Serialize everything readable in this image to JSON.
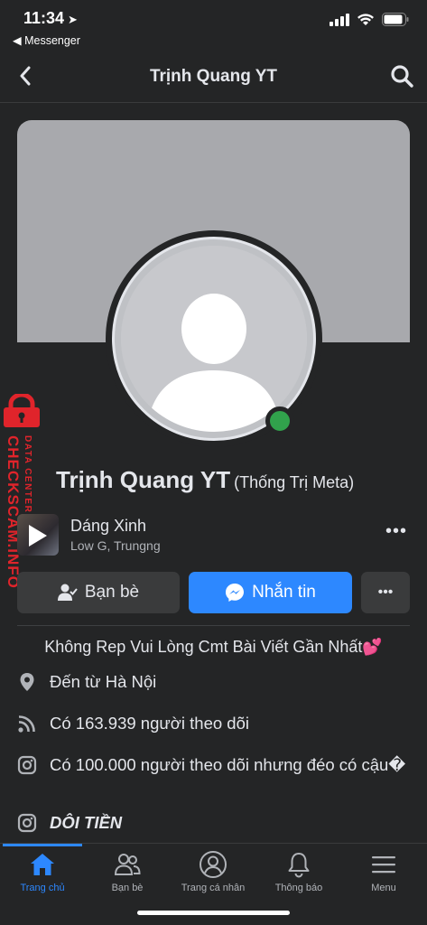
{
  "status_bar": {
    "time": "11:34",
    "back_app": "◀ Messenger"
  },
  "nav": {
    "title": "Trịnh Quang YT"
  },
  "profile": {
    "name": "Trịnh Quang YT",
    "nickname": "(Thống Trị Meta)"
  },
  "music": {
    "title": "Dáng Xinh",
    "artist": "Low G, Trungng",
    "more": "•••"
  },
  "actions": {
    "friends_label": "Bạn bè",
    "message_label": "Nhắn tin",
    "more_label": "•••"
  },
  "bio": "Không Rep Vui Lòng Cmt Bài Viết Gần Nhất💕",
  "info": {
    "location": "Đến từ Hà Nội",
    "followers": "Có 163.939 người theo dõi",
    "instagram_1": "Có 100.000 người theo dõi nhưng đéo có cậu�",
    "instagram_2": "DÔI TIỀN"
  },
  "watermark": {
    "site": "CHECKSCAM.INFO",
    "sub": "DATA CENTER"
  },
  "tabs": [
    {
      "label": "Trang chủ",
      "icon": "home-icon",
      "active": true
    },
    {
      "label": "Bạn bè",
      "icon": "friends-icon",
      "active": false
    },
    {
      "label": "Trang cá nhân",
      "icon": "profile-icon",
      "active": false
    },
    {
      "label": "Thông báo",
      "icon": "bell-icon",
      "active": false
    },
    {
      "label": "Menu",
      "icon": "menu-icon",
      "active": false
    }
  ],
  "colors": {
    "background": "#242526",
    "accent": "#2d88ff",
    "online": "#31a24c",
    "watermark": "#e0242b"
  }
}
